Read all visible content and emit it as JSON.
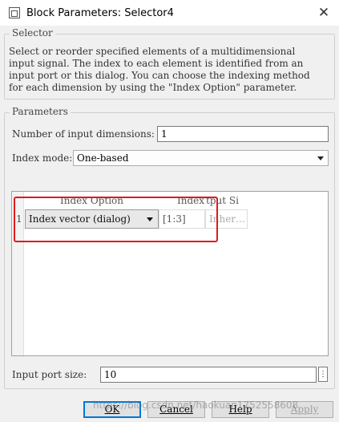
{
  "window": {
    "title": "Block Parameters: Selector4"
  },
  "selector_group": {
    "legend": "Selector",
    "description_lines": [
      "Select or reorder specified elements of a multidimensional",
      "input signal. The index to each element is identified from an",
      "input port or this dialog. You can choose the indexing method",
      "for each dimension by using the \"Index Option\" parameter."
    ]
  },
  "parameters_group": {
    "legend": "Parameters",
    "num_dims_label": "Number of input dimensions:",
    "num_dims_value": "1",
    "index_mode_label": "Index mode:",
    "index_mode_value": "One-based"
  },
  "table": {
    "headers": [
      "Index Option",
      "Index",
      "tput Si"
    ],
    "row_number": "1",
    "row": {
      "index_option": "Index vector (dialog)",
      "index": "[1:3]",
      "output_size": "Inher…"
    }
  },
  "input_port": {
    "label": "Input port size:",
    "value": "10",
    "stepper": "⋮"
  },
  "buttons": {
    "ok": "OK",
    "cancel": "Cancel",
    "help": "Help",
    "apply": "Apply"
  },
  "watermark": "https://blog.csdn.net/haokuan1752558608",
  "colors": {
    "highlight": "#e0191f",
    "default_button_border": "#0078d7"
  }
}
